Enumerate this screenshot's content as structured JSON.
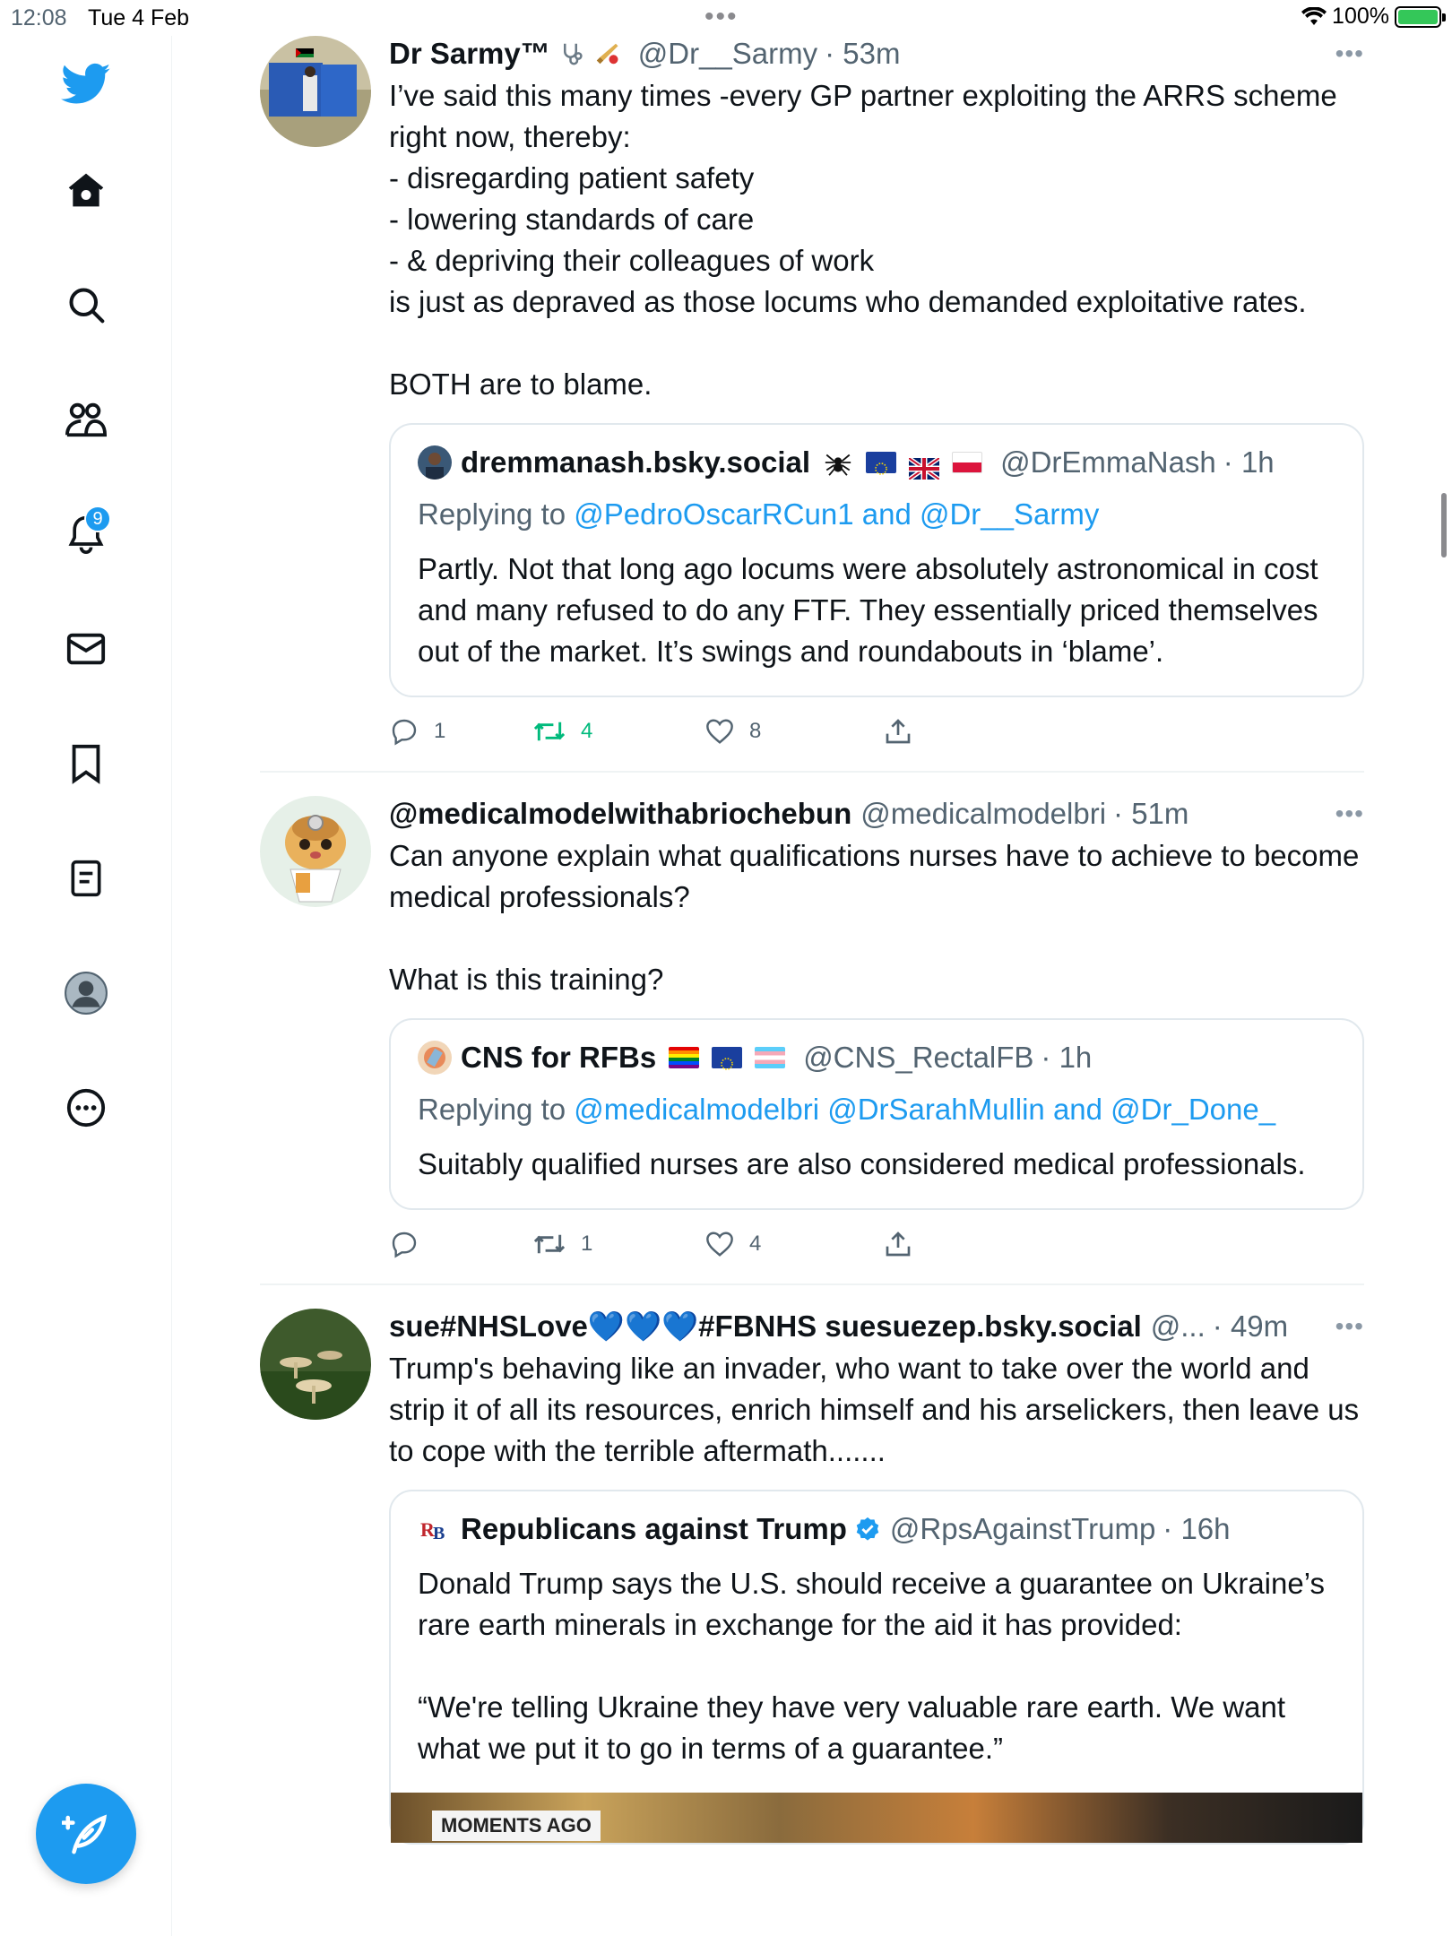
{
  "statusbar": {
    "time": "12:08",
    "date": "Tue 4 Feb",
    "battery": "100%"
  },
  "sidebar": {
    "notifications_badge": "9"
  },
  "tweets": [
    {
      "name": "Dr Sarmy™",
      "handle": "@Dr__Sarmy",
      "time": "· 53m",
      "text": "I’ve said this many times -every GP partner exploiting the ARRS scheme right now, thereby:\n- disregarding patient safety\n- lowering standards of care\n- & depriving their colleagues of work\nis just as depraved as those locums who demanded exploitative rates.\n\nBOTH are to blame.",
      "quote": {
        "name": "dremmanash.bsky.social",
        "handle": "@DrEmmaNash",
        "time": "· 1h",
        "reply_prefix": "Replying to",
        "reply_to": "@PedroOscarRCun1 and @Dr__Sarmy",
        "text": "Partly. Not that long ago locums were absolutely astronomical in cost and many refused to do any FTF. They essentially priced themselves out of the market. It’s swings and roundabouts in ‘blame’."
      },
      "replies": "1",
      "retweets": "4",
      "likes": "8"
    },
    {
      "name": "@medicalmodelwithabriochebun",
      "handle": "@medicalmodelbri",
      "time": "· 51m",
      "text": "Can anyone explain what qualifications nurses have to achieve to become medical professionals?\n\nWhat is this training?",
      "quote": {
        "name": "CNS for RFBs",
        "handle": "@CNS_RectalFB",
        "time": "· 1h",
        "reply_prefix": "Replying to",
        "reply_to": "@medicalmodelbri @DrSarahMullin and @Dr_Done_",
        "text": "Suitably qualified nurses are also considered medical professionals."
      },
      "replies": "",
      "retweets": "1",
      "likes": "4"
    },
    {
      "name": "sue#NHSLove💙💙💙#FBNHS suesuezep.bsky.social",
      "handle": "@...",
      "time": "· 49m",
      "text": "Trump's behaving like an invader, who want to take over the world and strip it of all its resources, enrich himself and his arselickers, then leave us to cope with the terrible aftermath.......",
      "quote": {
        "name": "Republicans against Trump",
        "handle": "@RpsAgainstTrump",
        "time": "· 16h",
        "text": "Donald Trump says the U.S. should receive a guarantee on Ukraine’s rare earth minerals in exchange for the aid it has provided:\n\n“We're telling Ukraine they have very valuable rare earth. We want what we put it to go in terms of a guarantee.”",
        "media_tag": "MOMENTS AGO"
      }
    }
  ]
}
